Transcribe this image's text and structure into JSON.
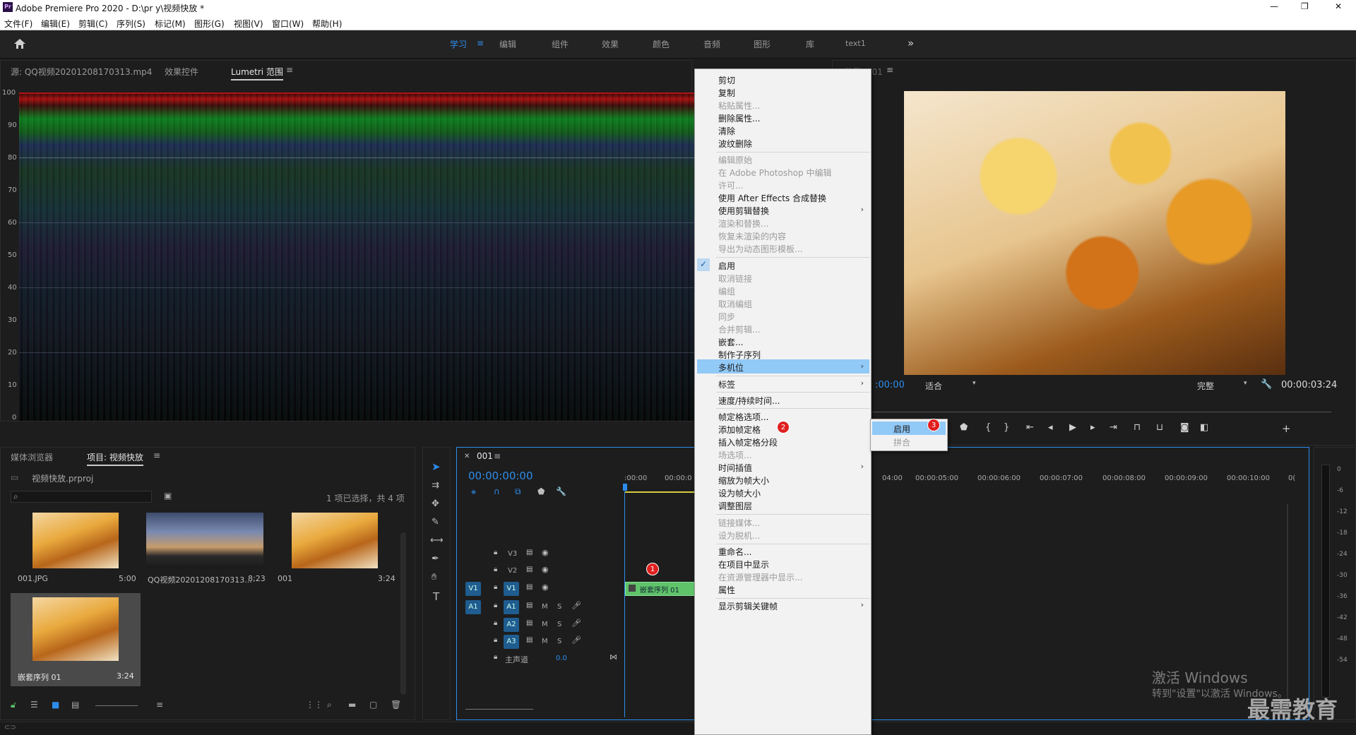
{
  "window": {
    "title": "Adobe Premiere Pro 2020 - D:\\pr y\\视频快放 *",
    "app_icon": "Pr",
    "controls": {
      "minimize": "—",
      "maximize": "❐",
      "close": "✕"
    }
  },
  "menubar": [
    "文件(F)",
    "编辑(E)",
    "剪辑(C)",
    "序列(S)",
    "标记(M)",
    "图形(G)",
    "视图(V)",
    "窗口(W)",
    "帮助(H)"
  ],
  "workspaces": {
    "items": [
      "学习",
      "编辑",
      "组件",
      "效果",
      "颜色",
      "音频",
      "图形",
      "库",
      "text1"
    ],
    "active": "学习",
    "more": "»"
  },
  "source_panel": {
    "tabs": [
      "源: QQ视频20201208170313.mp4",
      "效果控件",
      "Lumetri 范围"
    ],
    "active_tab": "Lumetri 范围",
    "scale": [
      "100",
      "90",
      "80",
      "70",
      "60",
      "50",
      "40",
      "30",
      "20",
      "10",
      "0"
    ]
  },
  "program_panel": {
    "tab_partial": "节目: 001",
    "timecode_left": ":00:00",
    "fit": "适合",
    "quality": "完整",
    "timecode_right": "00:00:03:24"
  },
  "project_panel": {
    "tabs": [
      "媒体浏览器",
      "项目: 视频快放"
    ],
    "active_tab": "项目: 视频快放",
    "project_file": "视频快放.prproj",
    "search_placeholder": "",
    "selection_info": "1 项已选择，共 4 项",
    "items": [
      {
        "name": "001.JPG",
        "duration": "5:00"
      },
      {
        "name": "QQ视频20201208170313...",
        "duration": "8;23"
      },
      {
        "name": "001",
        "duration": "3:24"
      },
      {
        "name": "嵌套序列 01",
        "duration": "3:24"
      }
    ]
  },
  "timeline": {
    "tab": "001",
    "timecode": "00:00:00:00",
    "ruler": [
      ":00:00",
      "00:00:0",
      "04:00",
      "00:00:05:00",
      "00:00:06:00",
      "00:00:07:00",
      "00:00:08:00",
      "00:00:09:00",
      "00:00:10:00",
      "0("
    ],
    "video_tracks": [
      {
        "name": "V3"
      },
      {
        "name": "V2"
      },
      {
        "name": "V1",
        "source": "V1"
      }
    ],
    "audio_tracks": [
      {
        "name": "A1",
        "source": "A1"
      },
      {
        "name": "A2"
      },
      {
        "name": "A3"
      }
    ],
    "master": {
      "label": "主声道",
      "value": "0.0"
    },
    "clip": {
      "label": "嵌套序列 01"
    },
    "track_buttons": {
      "mute": "M",
      "solo": "S"
    }
  },
  "meter": {
    "scale": [
      "0",
      "-6",
      "-12",
      "-18",
      "-24",
      "-30",
      "-36",
      "-42",
      "-48",
      "-54"
    ]
  },
  "context_menu": {
    "items": [
      {
        "label": "剪切",
        "enabled": true
      },
      {
        "label": "复制",
        "enabled": true
      },
      {
        "label": "粘贴属性...",
        "enabled": false
      },
      {
        "label": "删除属性...",
        "enabled": true
      },
      {
        "label": "清除",
        "enabled": true
      },
      {
        "label": "波纹删除",
        "enabled": true
      },
      {
        "label": "编辑原始",
        "enabled": false
      },
      {
        "label": "在 Adobe Photoshop 中编辑",
        "enabled": false
      },
      {
        "label": "许可...",
        "enabled": false
      },
      {
        "label": "使用 After Effects 合成替换",
        "enabled": true
      },
      {
        "label": "使用剪辑替换",
        "enabled": true,
        "submenu": true
      },
      {
        "label": "渲染和替换...",
        "enabled": false
      },
      {
        "label": "恢复未渲染的内容",
        "enabled": false
      },
      {
        "label": "导出为动态图形模板...",
        "enabled": false
      },
      {
        "label": "启用",
        "enabled": true,
        "checked": true
      },
      {
        "label": "取消链接",
        "enabled": false
      },
      {
        "label": "编组",
        "enabled": false
      },
      {
        "label": "取消编组",
        "enabled": false
      },
      {
        "label": "同步",
        "enabled": false
      },
      {
        "label": "合并剪辑...",
        "enabled": false
      },
      {
        "label": "嵌套...",
        "enabled": true
      },
      {
        "label": "制作子序列",
        "enabled": true
      },
      {
        "label": "多机位",
        "enabled": true,
        "submenu": true,
        "highlighted": true
      },
      {
        "label": "标签",
        "enabled": true,
        "submenu": true
      },
      {
        "label": "速度/持续时间...",
        "enabled": true
      },
      {
        "label": "帧定格选项...",
        "enabled": true
      },
      {
        "label": "添加帧定格",
        "enabled": true
      },
      {
        "label": "插入帧定格分段",
        "enabled": true
      },
      {
        "label": "场选项...",
        "enabled": false
      },
      {
        "label": "时间插值",
        "enabled": true,
        "submenu": true
      },
      {
        "label": "缩放为帧大小",
        "enabled": true
      },
      {
        "label": "设为帧大小",
        "enabled": true
      },
      {
        "label": "调整图层",
        "enabled": true
      },
      {
        "label": "链接媒体...",
        "enabled": false
      },
      {
        "label": "设为脱机...",
        "enabled": false
      },
      {
        "label": "重命名...",
        "enabled": true
      },
      {
        "label": "在项目中显示",
        "enabled": true
      },
      {
        "label": "在资源管理器中显示...",
        "enabled": false
      },
      {
        "label": "属性",
        "enabled": true
      },
      {
        "label": "显示剪辑关键帧",
        "enabled": true,
        "submenu": true
      }
    ]
  },
  "submenu": {
    "items": [
      {
        "label": "启用",
        "enabled": true,
        "highlighted": true
      },
      {
        "label": "拼合",
        "enabled": false
      }
    ]
  },
  "badges": [
    "1",
    "2",
    "3"
  ],
  "watermark": {
    "line1": "激活 Windows",
    "line2": "转到\"设置\"以激活 Windows。",
    "brand": "最需教育"
  },
  "icons": [
    "home-icon",
    "selection-tool-icon",
    "track-select-icon",
    "ripple-edit-icon",
    "razor-icon",
    "slip-icon",
    "pen-icon",
    "hand-icon",
    "type-icon",
    "play-icon",
    "wrench-icon",
    "camera-icon",
    "lock-icon",
    "eye-icon",
    "mic-icon",
    "search-icon",
    "trash-icon",
    "folder-icon"
  ],
  "colors": {
    "accent": "#2d8ceb",
    "highlight": "#91c9f7",
    "clip": "#5fc36a",
    "badge": "#e02020",
    "timecode": "#2d8ceb"
  }
}
